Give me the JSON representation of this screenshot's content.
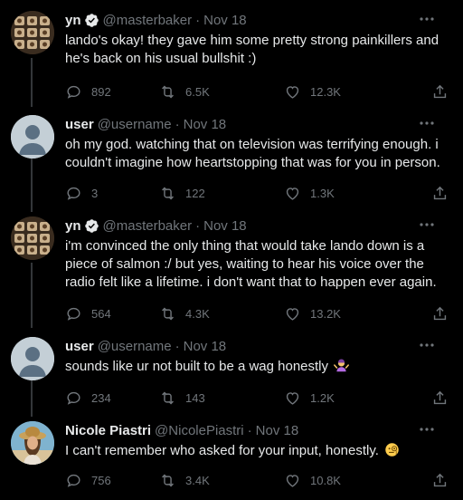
{
  "tweets": [
    {
      "name": "yn",
      "verified": true,
      "handle": "@masterbaker",
      "date": "Nov 18",
      "text": "lando's okay! they gave him some pretty strong painkillers and he's back on his usual bullshit :)",
      "replies": "892",
      "retweets": "6.5K",
      "likes": "12.3K",
      "avatar": "grid-photo-avatar"
    },
    {
      "name": "user",
      "verified": false,
      "handle": "@username",
      "date": "Nov 18",
      "text": "oh my god. watching that on television was terrifying enough. i couldn't imagine how heartstopping that was for you in person.",
      "replies": "3",
      "retweets": "122",
      "likes": "1.3K",
      "avatar": "default-avatar"
    },
    {
      "name": "yn",
      "verified": true,
      "handle": "@masterbaker",
      "date": "Nov 18",
      "text": "i'm convinced the only thing that would take lando down is a piece of salmon :/ but yes, waiting to hear his voice over the radio felt like a lifetime. i don't want that to happen ever again.",
      "replies": "564",
      "retweets": "4.3K",
      "likes": "13.2K",
      "avatar": "grid-photo-avatar"
    },
    {
      "name": "user",
      "verified": false,
      "handle": "@username",
      "date": "Nov 18",
      "text": "sounds like ur not built to be a wag honestly",
      "emoji": "person-shrugging-emoji",
      "replies": "234",
      "retweets": "143",
      "likes": "1.2K",
      "avatar": "default-avatar"
    },
    {
      "name": "Nicole Piastri",
      "verified": false,
      "handle": "@NicolePiastri",
      "date": "Nov 18",
      "text": "I can't remember who asked for your input, honestly.",
      "emoji": "face-with-monocle-emoji",
      "replies": "756",
      "retweets": "3.4K",
      "likes": "10.8K",
      "avatar": "photo-avatar"
    }
  ],
  "colors": {
    "background": "#000000",
    "text": "#e7e9ea",
    "secondary": "#71767b",
    "verified": "#1d9bf0",
    "thread_line": "#333639"
  }
}
